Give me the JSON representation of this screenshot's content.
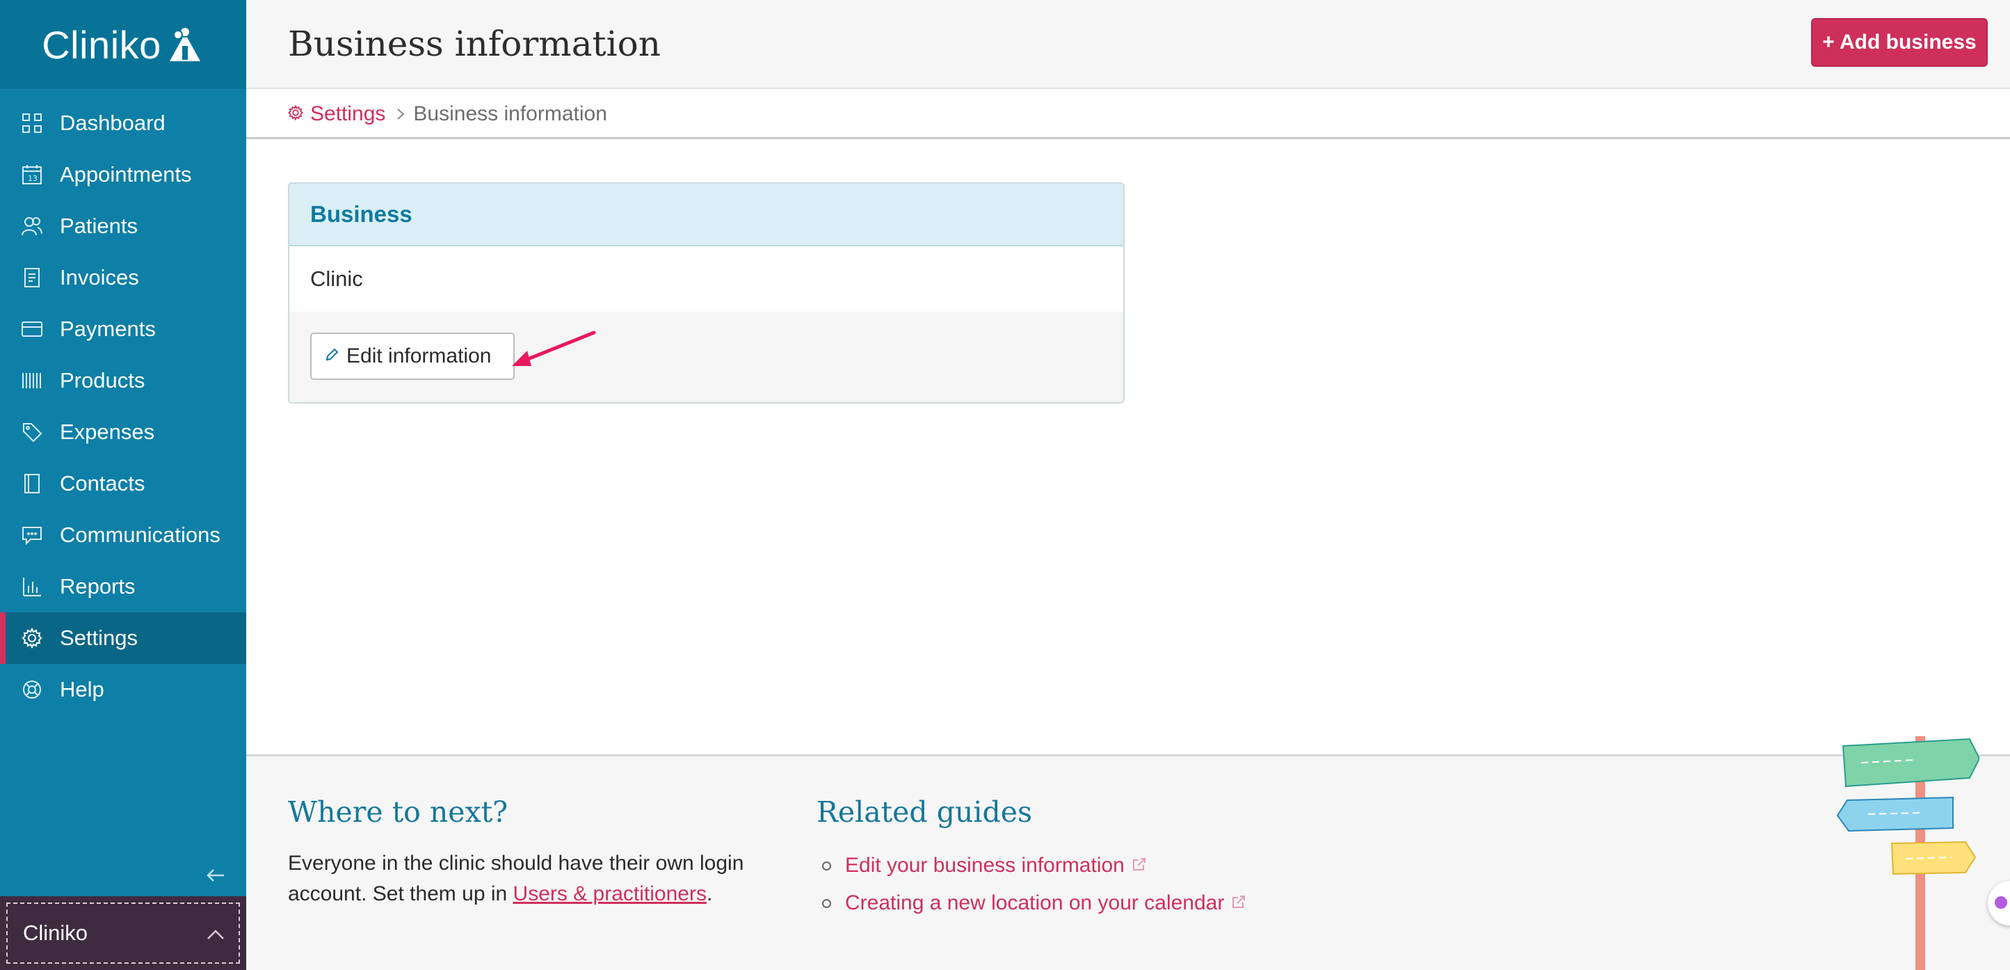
{
  "app": {
    "logo_text": "Cliniko",
    "accent_color": "#0e7fa6",
    "brand_pink": "#cf2f5b"
  },
  "sidebar": {
    "items": [
      {
        "label": "Dashboard",
        "icon": "grid-icon"
      },
      {
        "label": "Appointments",
        "icon": "calendar-icon"
      },
      {
        "label": "Patients",
        "icon": "people-icon"
      },
      {
        "label": "Invoices",
        "icon": "document-icon"
      },
      {
        "label": "Payments",
        "icon": "credit-card-icon"
      },
      {
        "label": "Products",
        "icon": "barcode-icon"
      },
      {
        "label": "Expenses",
        "icon": "tag-icon"
      },
      {
        "label": "Contacts",
        "icon": "address-book-icon"
      },
      {
        "label": "Communications",
        "icon": "chat-icon"
      },
      {
        "label": "Reports",
        "icon": "bar-chart-icon"
      },
      {
        "label": "Settings",
        "icon": "gear-icon",
        "active": true
      },
      {
        "label": "Help",
        "icon": "lifebuoy-icon"
      }
    ],
    "account_name": "Cliniko"
  },
  "header": {
    "title": "Business information",
    "add_button_label": "+ Add business"
  },
  "breadcrumb": {
    "parent": "Settings",
    "current": "Business information"
  },
  "card": {
    "title": "Business",
    "business_name": "Clinic",
    "edit_button_label": "Edit information"
  },
  "footer": {
    "next_heading": "Where to next?",
    "next_text_before": "Everyone in the clinic should have their own login account. Set them up in ",
    "next_link": "Users & practitioners",
    "next_text_after": ".",
    "guides_heading": "Related guides",
    "guides": [
      "Edit your business information",
      "Creating a new location on your calendar"
    ]
  }
}
